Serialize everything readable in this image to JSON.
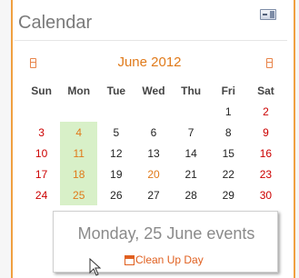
{
  "block": {
    "title": "Calendar",
    "toggle_icon": "hide-block-icon"
  },
  "calendar": {
    "month_label": "June 2012",
    "prev_icon": "previous-month-icon",
    "next_icon": "next-month-icon",
    "weekdays": [
      "Sun",
      "Mon",
      "Tue",
      "Wed",
      "Thu",
      "Fri",
      "Sat"
    ],
    "weeks": [
      [
        "",
        "",
        "",
        "",
        "",
        "1",
        "2"
      ],
      [
        "3",
        "4",
        "5",
        "6",
        "7",
        "8",
        "9"
      ],
      [
        "10",
        "11",
        "12",
        "13",
        "14",
        "15",
        "16"
      ],
      [
        "17",
        "18",
        "19",
        "20",
        "21",
        "22",
        "23"
      ],
      [
        "24",
        "25",
        "26",
        "27",
        "28",
        "29",
        "30"
      ]
    ],
    "highlight_color": "#d8f0c8",
    "event_color": "#e07a1a",
    "weekend_color": "#cc0000"
  },
  "popup": {
    "title": "Monday, 25 June events",
    "event_label": "Clean Up Day",
    "event_icon": "calendar-event-icon"
  }
}
